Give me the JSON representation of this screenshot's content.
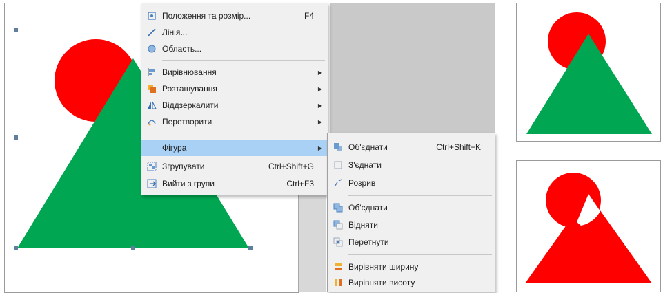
{
  "context_menu": {
    "items": [
      {
        "label": "Положення та розмір...",
        "shortcut": "F4",
        "icon": "position-size-icon"
      },
      {
        "label": "Лінія...",
        "shortcut": "",
        "icon": "line-icon"
      },
      {
        "label": "Область...",
        "shortcut": "",
        "icon": "area-icon"
      },
      {
        "label": "Вирівнювання",
        "shortcut": "",
        "icon": "align-icon",
        "submenu": true
      },
      {
        "label": "Розташування",
        "shortcut": "",
        "icon": "arrange-icon",
        "submenu": true
      },
      {
        "label": "Віддзеркалити",
        "shortcut": "",
        "icon": "flip-icon",
        "submenu": true
      },
      {
        "label": "Перетворити",
        "shortcut": "",
        "icon": "convert-icon",
        "submenu": true
      },
      {
        "label": "Фігура",
        "shortcut": "",
        "icon": "shape-icon",
        "submenu": true,
        "highlighted": true
      },
      {
        "label": "Згрупувати",
        "shortcut": "Ctrl+Shift+G",
        "icon": "group-icon"
      },
      {
        "label": "Вийти з групи",
        "shortcut": "Ctrl+F3",
        "icon": "exit-group-icon"
      }
    ]
  },
  "shape_submenu": {
    "items": [
      {
        "label": "Об'єднати",
        "shortcut": "Ctrl+Shift+K",
        "icon": "combine-icon"
      },
      {
        "label": "З'єднати",
        "shortcut": "",
        "icon": "connect-icon"
      },
      {
        "label": "Розрив",
        "shortcut": "",
        "icon": "break-icon"
      },
      {
        "label": "Об'єднати",
        "shortcut": "",
        "icon": "merge-icon"
      },
      {
        "label": "Відняти",
        "shortcut": "",
        "icon": "subtract-icon"
      },
      {
        "label": "Перетнути",
        "shortcut": "",
        "icon": "intersect-icon"
      },
      {
        "label": "Вирівняти ширину",
        "shortcut": "",
        "icon": "equalize-width-icon"
      },
      {
        "label": "Вирівняти висоту",
        "shortcut": "",
        "icon": "equalize-height-icon"
      }
    ]
  },
  "colors": {
    "circle": "#ff0000",
    "triangle_green": "#00a651",
    "highlight": "#a9d1f5",
    "menu_bg": "#f0f0f0"
  }
}
